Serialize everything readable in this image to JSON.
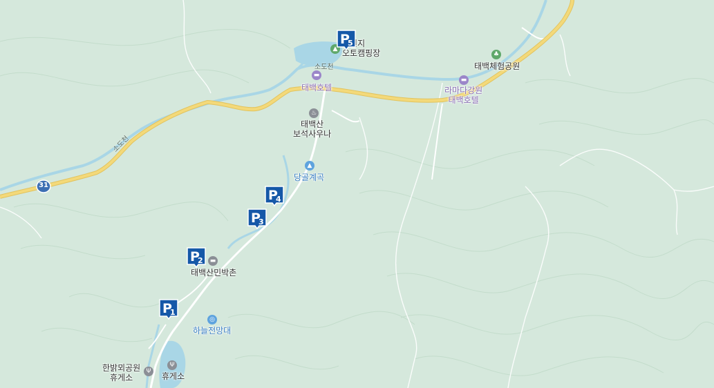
{
  "map": {
    "colors": {
      "land": "#d5e8dc",
      "contour": "#c3dccb",
      "ridge": "#ffffff",
      "road_main": "#f3d97a",
      "road_main_edge": "#e2c35d",
      "road_local": "#ffffff",
      "river": "#a9d6e6",
      "parking": "#1558a8"
    },
    "route_badge": "31",
    "stream_label": "소도천",
    "parking": [
      {
        "id": "p1",
        "num": "1"
      },
      {
        "id": "p2",
        "num": "2"
      },
      {
        "id": "p3",
        "num": "3"
      },
      {
        "id": "p4",
        "num": "4"
      },
      {
        "id": "p5",
        "num": "5"
      }
    ],
    "labels": {
      "camping": "소원지\n오토캠핑장",
      "hotel1": "태백호텔",
      "sauna": "태백산\n보석사우나",
      "valley": "당골계곡",
      "minbak": "태백산민박촌",
      "observatory": "하늘전망대",
      "rest1": "한밝뫼공원\n휴게소",
      "rest2": "휴게소",
      "park": "태백체험공원",
      "hotel2": "라마다강원\n태백호텔"
    },
    "icons": {
      "camping": "tent-icon",
      "hotel": "hotel-icon",
      "sauna": "spa-icon",
      "valley": "mountain-icon",
      "observatory": "viewpoint-icon",
      "rest": "restaurant-icon",
      "park": "park-icon"
    }
  }
}
